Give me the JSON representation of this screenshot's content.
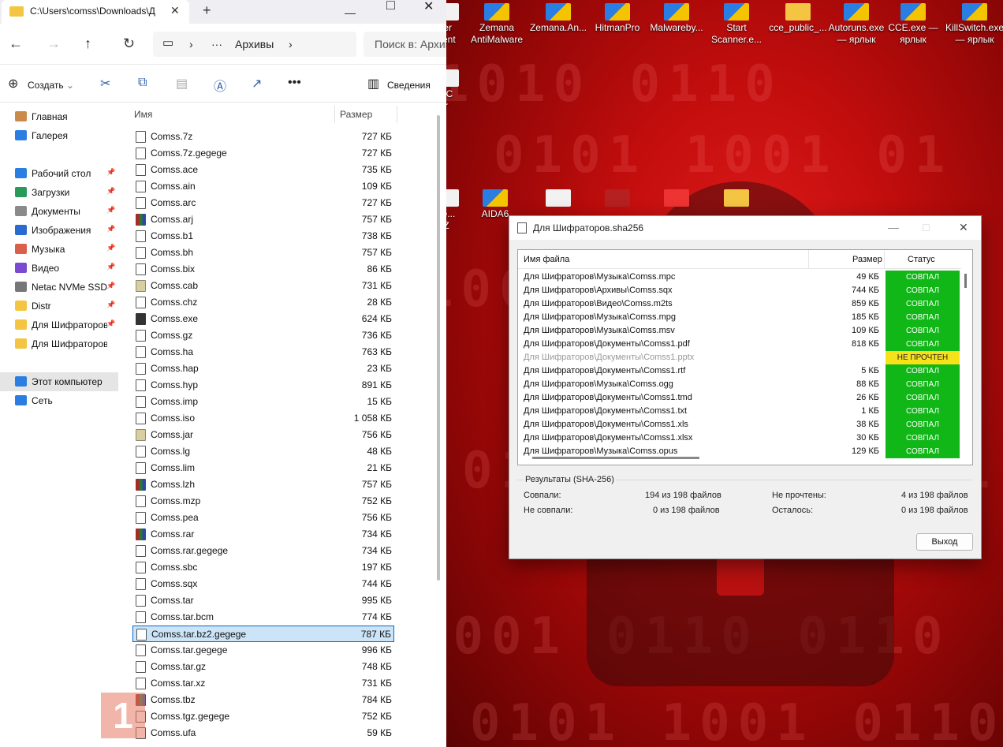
{
  "explorer": {
    "window_title": "C:\\Users\\comss\\Downloads\\Д",
    "address_segment": "Архивы",
    "search_placeholder": "Поиск в: Архив",
    "toolbar": {
      "create_label": "Создать",
      "details_label": "Сведения"
    },
    "columns": {
      "name": "Имя",
      "size": "Размер"
    },
    "sidebar": [
      {
        "label": "Главная",
        "icon": "home-icon",
        "pinned": false
      },
      {
        "label": "Галерея",
        "icon": "gallery-icon",
        "pinned": false
      },
      {
        "label": "Рабочий стол",
        "icon": "desktop-icon",
        "pinned": true
      },
      {
        "label": "Загрузки",
        "icon": "download-icon",
        "pinned": true
      },
      {
        "label": "Документы",
        "icon": "documents-icon",
        "pinned": true
      },
      {
        "label": "Изображения",
        "icon": "images-icon",
        "pinned": true
      },
      {
        "label": "Музыка",
        "icon": "music-icon",
        "pinned": true
      },
      {
        "label": "Видео",
        "icon": "video-icon",
        "pinned": true
      },
      {
        "label": "Netac NVMe SSD",
        "icon": "drive-icon",
        "pinned": true
      },
      {
        "label": "Distr",
        "icon": "folder-icon",
        "pinned": true
      },
      {
        "label": "Для Шифраторов",
        "icon": "folder-icon",
        "pinned": true
      },
      {
        "label": "Для Шифраторов",
        "icon": "folder-icon",
        "pinned": false
      },
      {
        "label": "Этот компьютер",
        "icon": "computer-icon",
        "pinned": false
      },
      {
        "label": "Сеть",
        "icon": "network-icon",
        "pinned": false
      }
    ],
    "files": [
      {
        "name": "Comss.7z",
        "size": "727 КБ",
        "type": "file"
      },
      {
        "name": "Comss.7z.gegege",
        "size": "727 КБ",
        "type": "file"
      },
      {
        "name": "Comss.ace",
        "size": "735 КБ",
        "type": "file"
      },
      {
        "name": "Comss.ain",
        "size": "109 КБ",
        "type": "file"
      },
      {
        "name": "Comss.arc",
        "size": "727 КБ",
        "type": "file"
      },
      {
        "name": "Comss.arj",
        "size": "757 КБ",
        "type": "archive"
      },
      {
        "name": "Comss.b1",
        "size": "738 КБ",
        "type": "file"
      },
      {
        "name": "Comss.bh",
        "size": "757 КБ",
        "type": "file"
      },
      {
        "name": "Comss.bix",
        "size": "86 КБ",
        "type": "file"
      },
      {
        "name": "Comss.cab",
        "size": "731 КБ",
        "type": "cab"
      },
      {
        "name": "Comss.chz",
        "size": "28 КБ",
        "type": "file"
      },
      {
        "name": "Comss.exe",
        "size": "624 КБ",
        "type": "exe"
      },
      {
        "name": "Comss.gz",
        "size": "736 КБ",
        "type": "file"
      },
      {
        "name": "Comss.ha",
        "size": "763 КБ",
        "type": "file"
      },
      {
        "name": "Comss.hap",
        "size": "23 КБ",
        "type": "file"
      },
      {
        "name": "Comss.hyp",
        "size": "891 КБ",
        "type": "file"
      },
      {
        "name": "Comss.imp",
        "size": "15 КБ",
        "type": "file"
      },
      {
        "name": "Comss.iso",
        "size": "1 058 КБ",
        "type": "file"
      },
      {
        "name": "Comss.jar",
        "size": "756 КБ",
        "type": "cab"
      },
      {
        "name": "Comss.lg",
        "size": "48 КБ",
        "type": "file"
      },
      {
        "name": "Comss.lim",
        "size": "21 КБ",
        "type": "file"
      },
      {
        "name": "Comss.lzh",
        "size": "757 КБ",
        "type": "archive"
      },
      {
        "name": "Comss.mzp",
        "size": "752 КБ",
        "type": "file"
      },
      {
        "name": "Comss.pea",
        "size": "756 КБ",
        "type": "file"
      },
      {
        "name": "Comss.rar",
        "size": "734 КБ",
        "type": "archive"
      },
      {
        "name": "Comss.rar.gegege",
        "size": "734 КБ",
        "type": "file"
      },
      {
        "name": "Comss.sbc",
        "size": "197 КБ",
        "type": "file"
      },
      {
        "name": "Comss.sqx",
        "size": "744 КБ",
        "type": "file"
      },
      {
        "name": "Comss.tar",
        "size": "995 КБ",
        "type": "file"
      },
      {
        "name": "Comss.tar.bcm",
        "size": "774 КБ",
        "type": "file"
      },
      {
        "name": "Comss.tar.bz2.gegege",
        "size": "787 КБ",
        "type": "file",
        "selected": true
      },
      {
        "name": "Comss.tar.gegege",
        "size": "996 КБ",
        "type": "file"
      },
      {
        "name": "Comss.tar.gz",
        "size": "748 КБ",
        "type": "file"
      },
      {
        "name": "Comss.tar.xz",
        "size": "731 КБ",
        "type": "file"
      },
      {
        "name": "Comss.tbz",
        "size": "784 КБ",
        "type": "archive"
      },
      {
        "name": "Comss.tgz.gegege",
        "size": "752 КБ",
        "type": "file"
      },
      {
        "name": "Comss.ufa",
        "size": "59 КБ",
        "type": "file"
      }
    ]
  },
  "desktop": {
    "icons": [
      {
        "label": "ter\nnent",
        "icon": "app-icon"
      },
      {
        "label": "Zemana\nAntiMalware",
        "icon": "shield-icon"
      },
      {
        "label": "Zemana.An...",
        "icon": "shield-icon"
      },
      {
        "label": "HitmanPro",
        "icon": "shield-icon"
      },
      {
        "label": "Malwareby...",
        "icon": "shield-icon"
      },
      {
        "label": "Start\nScanner.e...",
        "icon": "shield-icon"
      },
      {
        "label": "cce_public_...",
        "icon": "folder-icon"
      },
      {
        "label": "Autoruns.exe\n— ярлык",
        "icon": "shield-icon"
      },
      {
        "label": "CCE.exe —\nярлык",
        "icon": "shield-icon"
      },
      {
        "label": "KillSwitch.exe\n— ярлык",
        "icon": "shield-icon"
      },
      {
        "label": "PC\nr",
        "icon": "app-icon"
      },
      {
        "label": "ve...\nZ",
        "icon": "app-icon"
      },
      {
        "label": "AIDA6",
        "icon": "aida-icon"
      },
      {
        "label": "",
        "icon": "scan-icon"
      },
      {
        "label": "",
        "icon": "hash-icon"
      },
      {
        "label": "",
        "icon": "tool-icon"
      },
      {
        "label": "",
        "icon": "folder-icon"
      }
    ]
  },
  "dialog": {
    "title": "Для Шифраторов.sha256",
    "columns": {
      "name": "Имя файла",
      "size": "Размер",
      "status": "Статус"
    },
    "rows": [
      {
        "name": "Для Шифраторов\\Музыка\\Comss.mpc",
        "size": "49 КБ",
        "status": "СОВПАЛ",
        "ok": true
      },
      {
        "name": "Для Шифраторов\\Архивы\\Comss.sqx",
        "size": "744 КБ",
        "status": "СОВПАЛ",
        "ok": true
      },
      {
        "name": "Для Шифраторов\\Видео\\Comss.m2ts",
        "size": "859 КБ",
        "status": "СОВПАЛ",
        "ok": true
      },
      {
        "name": "Для Шифраторов\\Музыка\\Comss.mpg",
        "size": "185 КБ",
        "status": "СОВПАЛ",
        "ok": true
      },
      {
        "name": "Для Шифраторов\\Музыка\\Comss.msv",
        "size": "109 КБ",
        "status": "СОВПАЛ",
        "ok": true
      },
      {
        "name": "Для Шифраторов\\Документы\\Comss1.pdf",
        "size": "818 КБ",
        "status": "СОВПАЛ",
        "ok": true
      },
      {
        "name": "Для Шифраторов\\Документы\\Comss1.pptx",
        "size": "",
        "status": "НЕ ПРОЧТЕН",
        "ok": false
      },
      {
        "name": "Для Шифраторов\\Документы\\Comss1.rtf",
        "size": "5 КБ",
        "status": "СОВПАЛ",
        "ok": true
      },
      {
        "name": "Для Шифраторов\\Музыка\\Comss.ogg",
        "size": "88 КБ",
        "status": "СОВПАЛ",
        "ok": true
      },
      {
        "name": "Для Шифраторов\\Документы\\Comss1.tmd",
        "size": "26 КБ",
        "status": "СОВПАЛ",
        "ok": true
      },
      {
        "name": "Для Шифраторов\\Документы\\Comss1.txt",
        "size": "1 КБ",
        "status": "СОВПАЛ",
        "ok": true
      },
      {
        "name": "Для Шифраторов\\Документы\\Comss1.xls",
        "size": "38 КБ",
        "status": "СОВПАЛ",
        "ok": true
      },
      {
        "name": "Для Шифраторов\\Документы\\Comss1.xlsx",
        "size": "30 КБ",
        "status": "СОВПАЛ",
        "ok": true
      },
      {
        "name": "Для Шифраторов\\Музыка\\Comss.opus",
        "size": "129 КБ",
        "status": "СОВПАЛ",
        "ok": true
      }
    ],
    "results": {
      "title": "Результаты (SHA-256)",
      "matched_label": "Совпали:",
      "matched_value": "194 из 198 файлов",
      "mismatched_label": "Не совпали:",
      "mismatched_value": "0 из 198 файлов",
      "unread_label": "Не прочтены:",
      "unread_value": "4 из 198 файлов",
      "remaining_label": "Осталось:",
      "remaining_value": "0 из 198 файлов"
    },
    "exit_label": "Выход"
  },
  "colors": {
    "status_ok": "#11b617",
    "status_warn": "#f7e21a",
    "selection": "#cce4f7",
    "desktop_red": "#c20d0d"
  }
}
